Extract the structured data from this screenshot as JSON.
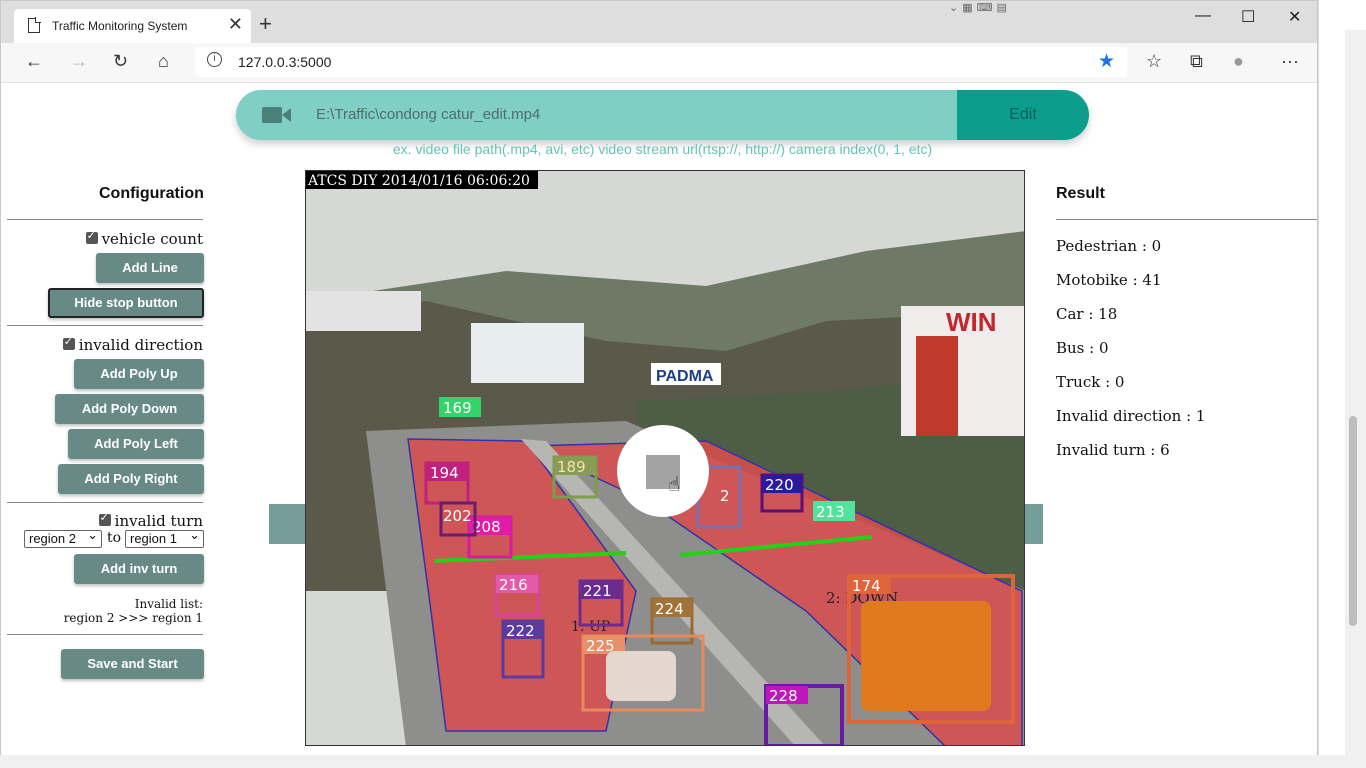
{
  "browser": {
    "tab_title": "Traffic Monitoring System",
    "tab_close": "✕",
    "new_tab": "+",
    "url": "127.0.0.3:5000",
    "icons": [
      "back-icon",
      "forward-icon",
      "refresh-icon",
      "home-icon",
      "info-icon",
      "star-icon",
      "favorites-icon",
      "collections-icon",
      "profile-icon",
      "more-icon"
    ],
    "accent": "#1a73e8"
  },
  "source": {
    "path": "E:\\Traffic\\condong catur_edit.mp4",
    "edit_label": "Edit",
    "hint": "ex. video file path(.mp4, avi, etc) video stream url(rtsp://, http://) camera index(0, 1, etc)",
    "accent": "#7fcfc4",
    "edit_color": "#0c9e8c"
  },
  "config": {
    "title": "Configuration",
    "vehicle_count": "vehicle count",
    "add_line": "Add Line",
    "hide_stop": "Hide stop button",
    "invalid_direction": "invalid direction",
    "add_poly_up": "Add Poly Up",
    "add_poly_down": "Add Poly Down",
    "add_poly_left": "Add Poly Left",
    "add_poly_right": "Add Poly Right",
    "invalid_turn": "invalid turn",
    "from_region": "region 2",
    "to_label": "to",
    "to_region": "region 1",
    "add_inv_turn": "Add inv turn",
    "invalid_list_label": "Invalid list:",
    "invalid_list_item": "region 2 >>> region 1",
    "save_start": "Save and Start",
    "button_color": "#678a87"
  },
  "video": {
    "timestamp": "ATCS DIY 2014/01/16 06:06:20",
    "region_up": "1: UP",
    "region_down": "2: DOWN",
    "billboard_text": "WIN",
    "sign_text": "PADMA",
    "track_ids": [
      "169",
      "194",
      "189",
      "220",
      "213",
      "208",
      "202",
      "216",
      "221",
      "224",
      "222",
      "225",
      "174",
      "228",
      "2"
    ]
  },
  "result": {
    "title": "Result",
    "lines": [
      "Pedestrian : 0",
      "Motobike : 41",
      "Car : 18",
      "Bus : 0",
      "Truck : 0",
      "Invalid direction : 1",
      "Invalid turn : 6"
    ]
  }
}
